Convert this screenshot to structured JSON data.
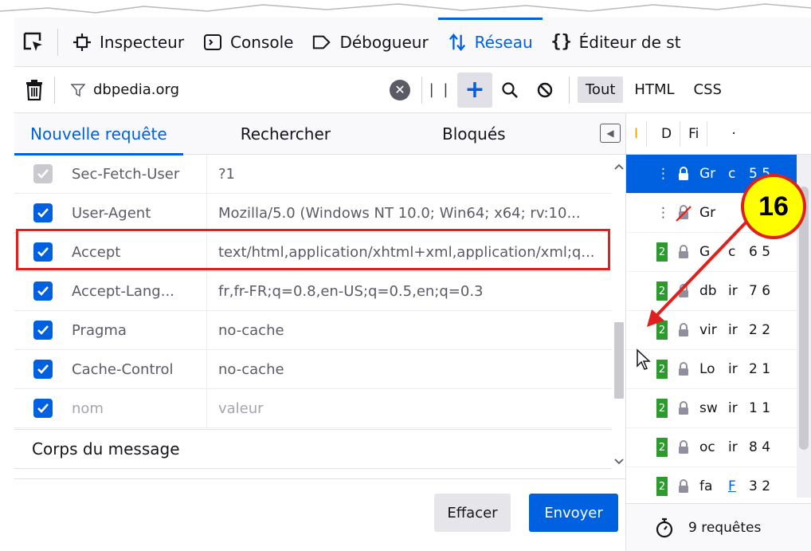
{
  "toolbox": {
    "tabs": [
      {
        "label": "Inspecteur",
        "icon": "inspector-icon"
      },
      {
        "label": "Console",
        "icon": "console-icon"
      },
      {
        "label": "Débogueur",
        "icon": "debugger-icon"
      },
      {
        "label": "Réseau",
        "icon": "network-icon",
        "active": true
      },
      {
        "label": "Éditeur de st",
        "icon": "style-editor-icon"
      }
    ]
  },
  "filterbar": {
    "filter_value": "dbpedia.org",
    "types": [
      "Tout",
      "HTML",
      "CSS"
    ]
  },
  "panel": {
    "tabs": [
      "Nouvelle requête",
      "Rechercher",
      "Bloqués"
    ],
    "headers": [
      {
        "name": "Sec-Fetch-User",
        "value": "?1",
        "checked": true,
        "disabled": true
      },
      {
        "name": "User-Agent",
        "value": "Mozilla/5.0 (Windows NT 10.0; Win64; x64; rv:10...",
        "checked": true
      },
      {
        "name": "Accept",
        "value": "text/html,application/xhtml+xml,application/xml;q...",
        "checked": true
      },
      {
        "name": "Accept-Lang...",
        "value": "fr,fr-FR;q=0.8,en-US;q=0.5,en;q=0.3",
        "checked": true
      },
      {
        "name": "Pragma",
        "value": "no-cache",
        "checked": true
      },
      {
        "name": "Cache-Control",
        "value": "no-cache",
        "checked": true
      },
      {
        "name": "nom",
        "value": "valeur",
        "checked": true,
        "placeholder": true
      }
    ],
    "body_section": "Corps du message",
    "clear_label": "Effacer",
    "send_label": "Envoyer"
  },
  "requests": {
    "header": [
      "I",
      "D",
      "Fi",
      "·"
    ],
    "rows": [
      {
        "status": "",
        "name": "Gr",
        "type": "c",
        "size": "5 5",
        "selected": true
      },
      {
        "status": "",
        "name": "Gr",
        "type": "",
        "size": "",
        "blocked": true
      },
      {
        "status": "2",
        "name": "G",
        "type": "c",
        "size": "6 5"
      },
      {
        "status": "2",
        "name": "db",
        "type": "ir",
        "size": "7 6"
      },
      {
        "status": "2",
        "name": "vir",
        "type": "ir",
        "size": "2 2"
      },
      {
        "status": "2",
        "name": "Lo",
        "type": "ir",
        "size": "2 1"
      },
      {
        "status": "2",
        "name": "sw",
        "type": "ir",
        "size": "1 1"
      },
      {
        "status": "2",
        "name": "oc",
        "type": "ir",
        "size": "8 4"
      },
      {
        "status": "2",
        "name": "fa",
        "type": "F",
        "size": "3 2"
      }
    ],
    "summary": "9 requêtes"
  },
  "annotation": {
    "number": "16"
  }
}
